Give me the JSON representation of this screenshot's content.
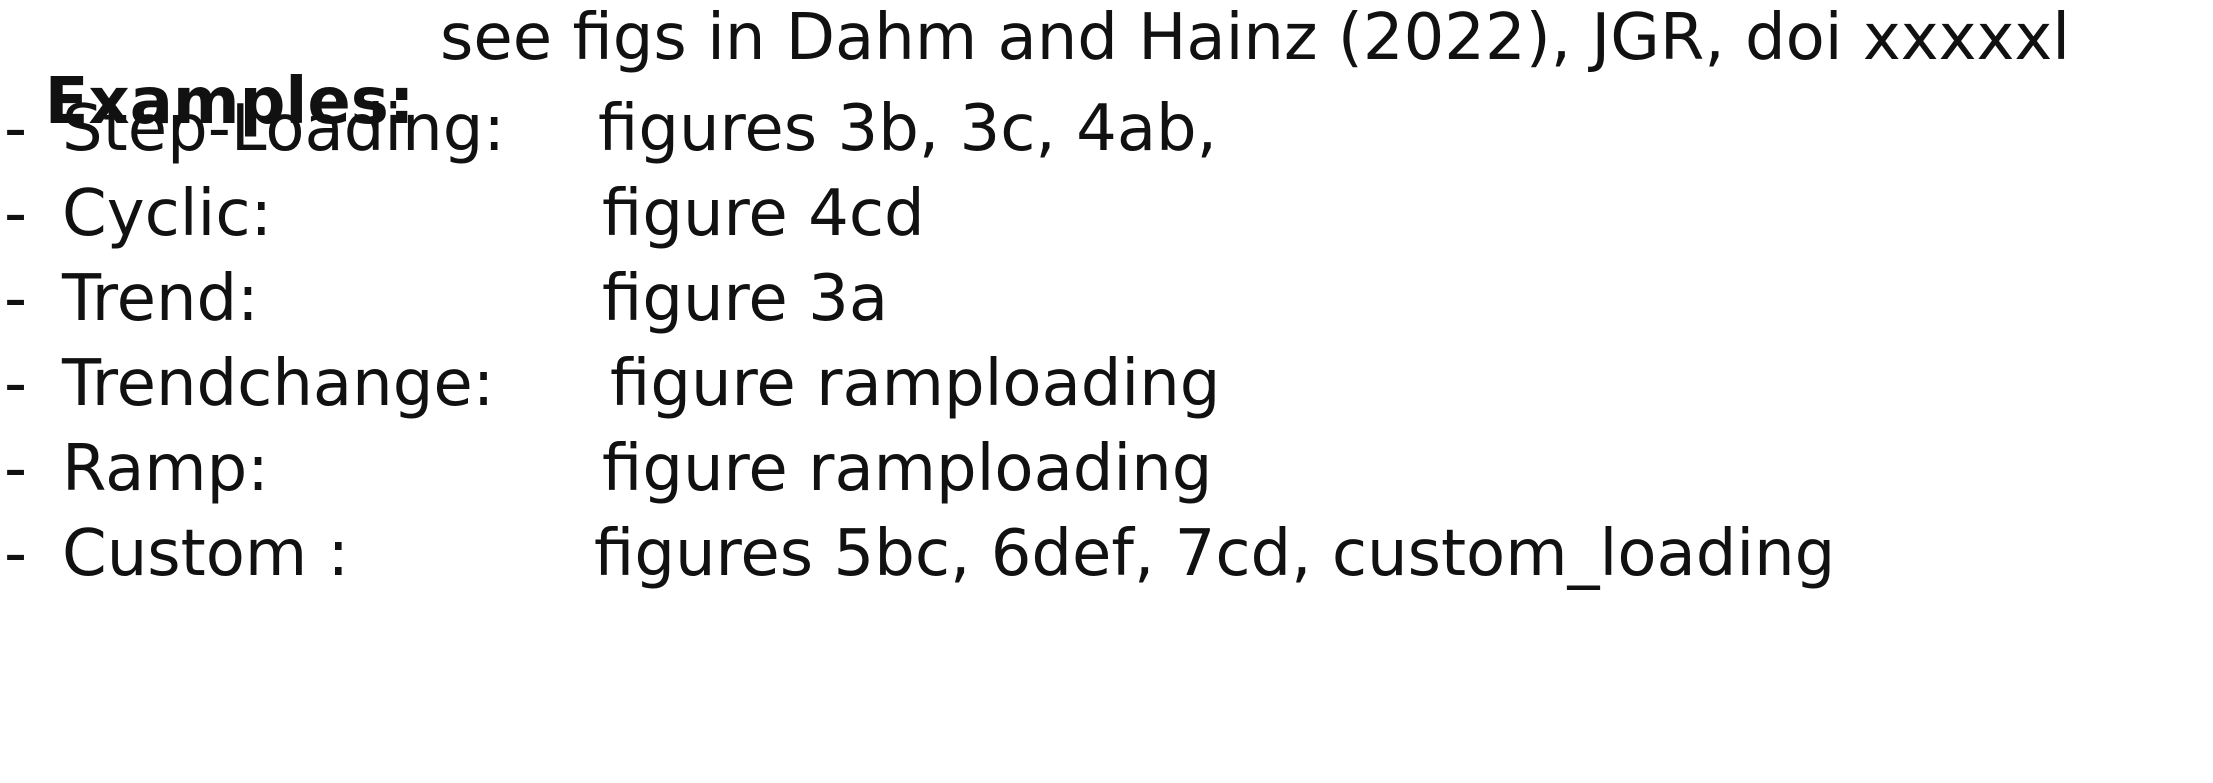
{
  "heading": {
    "label": "Examples:",
    "text": "see figs in Dahm and Hainz (2022), JGR, doi xxxxxl"
  },
  "items": [
    {
      "dash": "-",
      "label": "Step-Loading:",
      "value": "figures 3b, 3c, 4ab,"
    },
    {
      "dash": "-",
      "label": "Cyclic:",
      "value": "figure 4cd"
    },
    {
      "dash": "-",
      "label": "Trend:",
      "value": "figure 3a"
    },
    {
      "dash": "-",
      "label": "Trendchange:",
      "value": "figure ramploading"
    },
    {
      "dash": "-",
      "label": "Ramp:",
      "value": "figure ramploading"
    },
    {
      "dash": "-",
      "label": "Custom :",
      "value": "figures 5bc, 6def, 7cd, custom_loading"
    }
  ]
}
